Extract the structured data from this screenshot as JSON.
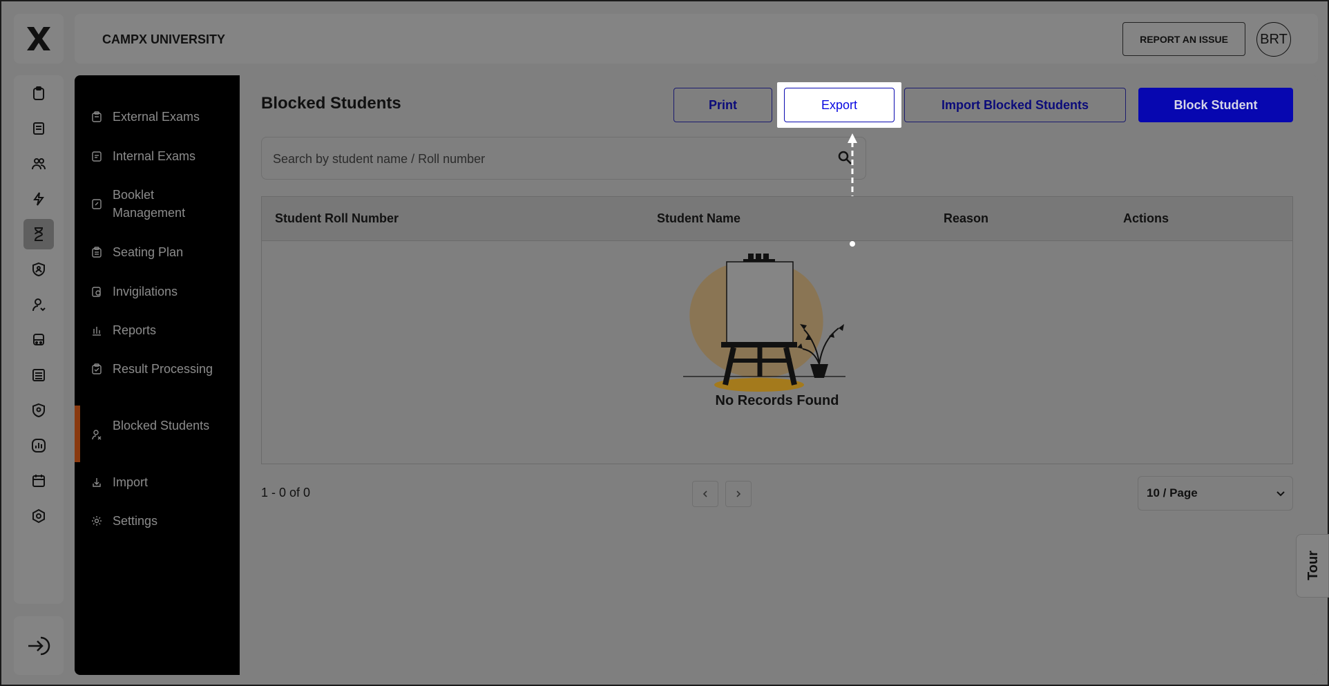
{
  "header": {
    "university_name": "CAMPX UNIVERSITY",
    "report_issue_label": "REPORT AN ISSUE",
    "avatar_initials": "BRT"
  },
  "rail": {
    "logo": "campx-x-logo",
    "icons": [
      "clipboard-icon",
      "book-icon",
      "users-icon",
      "lightning-icon",
      "hourglass-icon",
      "shield-user-icon",
      "user-refresh-icon",
      "bus-icon",
      "ledger-icon",
      "shield-location-icon",
      "chart-icon",
      "calendar-icon",
      "hexagon-settings-icon"
    ],
    "active_icon": "hourglass-icon",
    "logout_icon": "logout-icon"
  },
  "sidebar": {
    "items": [
      {
        "label": "External Exams",
        "icon": "clipboard-icon"
      },
      {
        "label": "Internal Exams",
        "icon": "document-icon"
      },
      {
        "label": "Booklet Management",
        "icon": "booklet-icon"
      },
      {
        "label": "Seating Plan",
        "icon": "clipboard-list-icon"
      },
      {
        "label": "Invigilations",
        "icon": "doc-search-icon"
      },
      {
        "label": "Reports",
        "icon": "bar-chart-icon"
      },
      {
        "label": "Result Processing",
        "icon": "clipboard-check-icon"
      },
      {
        "label": "Blocked Students",
        "icon": "user-block-icon"
      },
      {
        "label": "Import",
        "icon": "download-icon"
      },
      {
        "label": "Settings",
        "icon": "gear-icon"
      }
    ],
    "active_item": "Blocked Students"
  },
  "main": {
    "title": "Blocked Students",
    "buttons": {
      "print": "Print",
      "export": "Export",
      "import": "Import Blocked Students",
      "block": "Block Student"
    },
    "search": {
      "placeholder": "Search by student name / Roll number",
      "value": ""
    },
    "table": {
      "columns": [
        "Student Roll Number",
        "Student Name",
        "Reason",
        "Actions"
      ],
      "rows": [],
      "empty_text": "No Records Found"
    },
    "pagination": {
      "range_text": "1 - 0 of 0",
      "page_size": "10 / Page"
    }
  },
  "tour": {
    "label": "Tour"
  },
  "colors": {
    "primary": "#0707b0",
    "sidebar_bg": "#000000",
    "active_marker": "#8a3a10",
    "overlay_bg": "#7f7f7f"
  }
}
